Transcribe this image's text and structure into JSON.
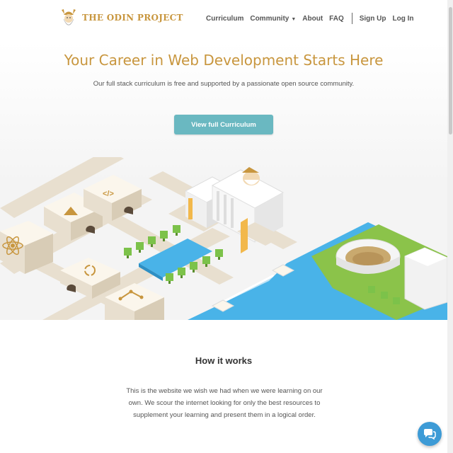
{
  "header": {
    "logo_text": "THE ODIN PROJECT",
    "nav": {
      "curriculum": "Curriculum",
      "community": "Community",
      "about": "About",
      "faq": "FAQ",
      "sign_up": "Sign Up",
      "log_in": "Log In"
    }
  },
  "hero": {
    "title": "Your Career in Web Development Starts Here",
    "subtitle": "Our full stack curriculum is free and supported by a passionate open source community.",
    "cta_label": "View full Curriculum"
  },
  "how_it_works": {
    "title": "How it works",
    "body": "This is the website we wish we had when we were learning on our own. We scour the internet looking for only the best resources to supplement your learning and present them in a logical order."
  },
  "icons": {
    "logo": "viking-logo-icon",
    "chat": "chat-bubble-icon",
    "caret": "chevron-down-icon"
  },
  "colors": {
    "brand": "#c8963e",
    "button": "#6ab8c1",
    "chat": "#3d9bd6",
    "water": "#49b3e8",
    "grass": "#8bc34a"
  }
}
